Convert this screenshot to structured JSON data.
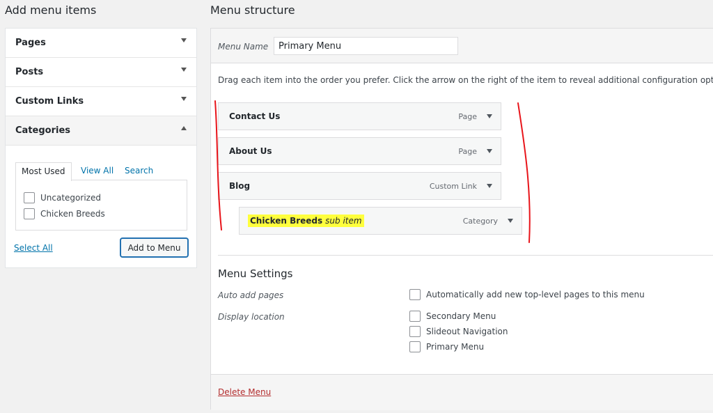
{
  "left": {
    "heading": "Add menu items",
    "accordion": [
      {
        "label": "Pages"
      },
      {
        "label": "Posts"
      },
      {
        "label": "Custom Links"
      },
      {
        "label": "Categories"
      }
    ],
    "categories": {
      "tabs": [
        "Most Used",
        "View All",
        "Search"
      ],
      "items": [
        "Uncategorized",
        "Chicken Breeds"
      ],
      "select_all": "Select All",
      "add_button": "Add to Menu"
    }
  },
  "right": {
    "heading": "Menu structure",
    "menu_name_label": "Menu Name",
    "menu_name_value": "Primary Menu",
    "instructions": "Drag each item into the order you prefer. Click the arrow on the right of the item to reveal additional configuration options.",
    "items": [
      {
        "title": "Contact Us",
        "type": "Page"
      },
      {
        "title": "About Us",
        "type": "Page"
      },
      {
        "title": "Blog",
        "type": "Custom Link"
      },
      {
        "title": "Chicken Breeds",
        "note": "sub item",
        "type": "Category"
      }
    ],
    "settings": {
      "title": "Menu Settings",
      "auto_add_label": "Auto add pages",
      "auto_add_option": "Automatically add new top-level pages to this menu",
      "display_location_label": "Display location",
      "locations": [
        "Secondary Menu",
        "Slideout Navigation",
        "Primary Menu"
      ]
    },
    "delete_menu": "Delete Menu"
  },
  "colors": {
    "link": "#0073aa",
    "highlight": "#ffff3d",
    "annotation": "#e8141a",
    "delete": "#b32d2e"
  }
}
